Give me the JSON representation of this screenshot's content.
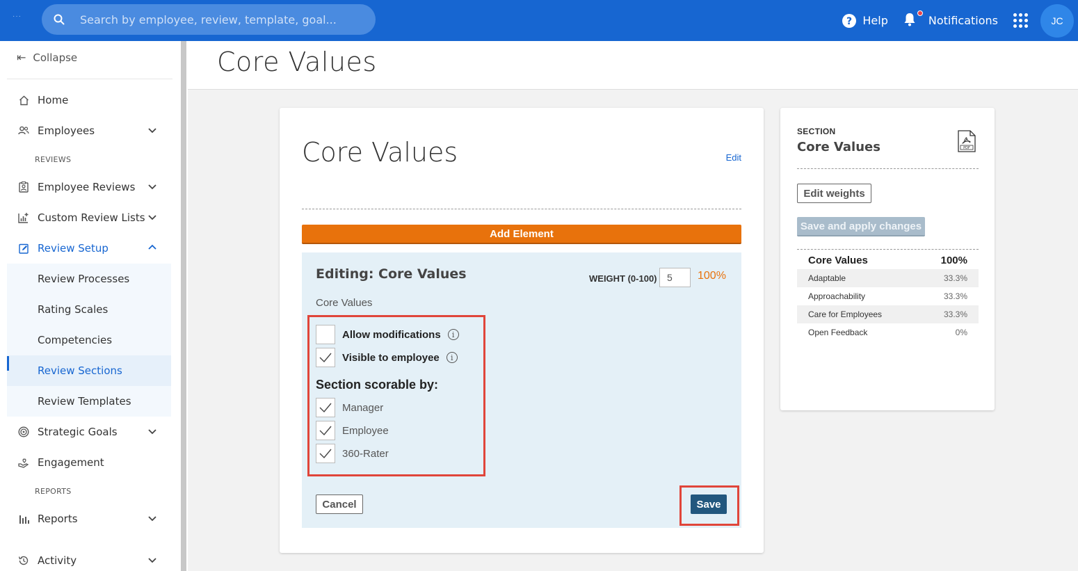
{
  "topbar": {
    "search_placeholder": "Search by employee, review, template, goal...",
    "help_label": "Help",
    "notifications_label": "Notifications",
    "avatar_initials": "JC"
  },
  "sidebar": {
    "collapse_label": "Collapse",
    "home": "Home",
    "employees": "Employees",
    "reviews_heading": "REVIEWS",
    "employee_reviews": "Employee Reviews",
    "custom_review_lists": "Custom Review Lists",
    "review_setup": "Review Setup",
    "sub_items": [
      "Review Processes",
      "Rating Scales",
      "Competencies",
      "Review Sections",
      "Review Templates"
    ],
    "selected_sub_item": "Review Sections",
    "strategic_goals": "Strategic Goals",
    "engagement": "Engagement",
    "reports_heading": "REPORTS",
    "reports": "Reports",
    "activity": "Activity"
  },
  "header": {
    "title": "Core Values"
  },
  "card": {
    "title": "Core Values",
    "edit_link": "Edit",
    "add_element_label": "Add Element",
    "editing_title": "Editing: Core Values",
    "weight_label": "WEIGHT (0-100)",
    "weight_value": "5",
    "weight_percent": "100%",
    "section_name": "Core Values",
    "allow_modifications_label": "Allow modifications",
    "allow_modifications_checked": false,
    "visible_to_employee_label": "Visible to employee",
    "visible_to_employee_checked": true,
    "scorable_heading": "Section scorable by:",
    "scorable_options": [
      {
        "label": "Manager",
        "checked": true
      },
      {
        "label": "Employee",
        "checked": true
      },
      {
        "label": "360-Rater",
        "checked": true
      }
    ],
    "cancel_label": "Cancel",
    "save_label": "Save"
  },
  "side": {
    "section_label": "SECTION",
    "title": "Core Values",
    "edit_weights_label": "Edit weights",
    "save_apply_label": "Save and apply changes",
    "weights": {
      "total_name": "Core Values",
      "total_pct": "100%",
      "rows": [
        {
          "name": "Adaptable",
          "pct": "33.3%"
        },
        {
          "name": "Approachability",
          "pct": "33.3%"
        },
        {
          "name": "Care for Employees",
          "pct": "33.3%"
        },
        {
          "name": "Open Feedback",
          "pct": "0%"
        }
      ]
    }
  },
  "colors": {
    "brand_blue": "#1766d1",
    "accent_orange": "#e8720c",
    "save_navy": "#22577e",
    "highlight_red": "#e0453a"
  }
}
